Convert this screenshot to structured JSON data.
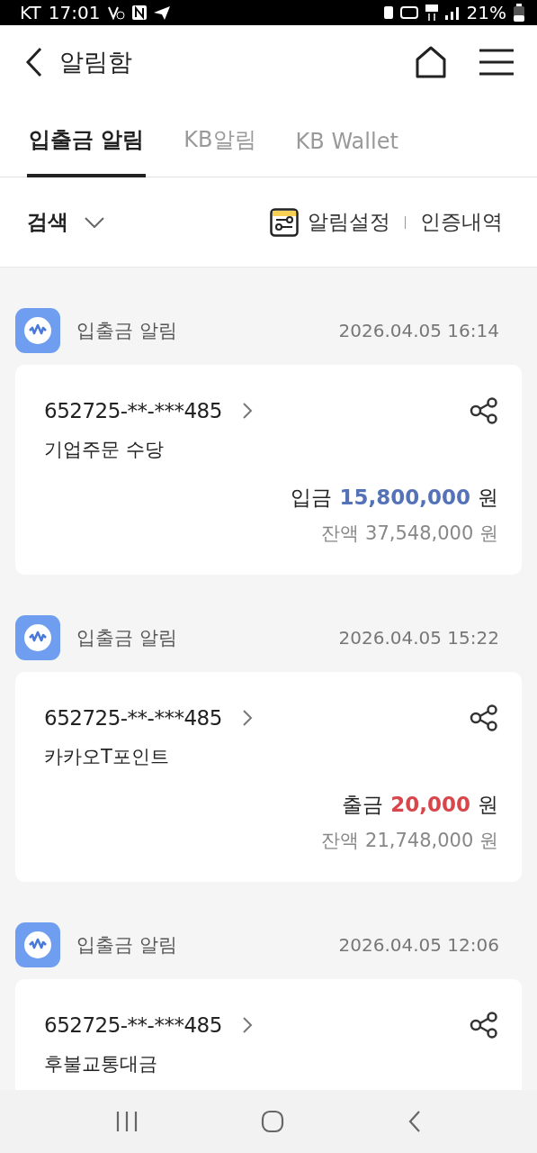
{
  "status_bar": {
    "carrier": "KT",
    "time": "17:01",
    "battery": "21%"
  },
  "header": {
    "title": "알림함"
  },
  "tabs": [
    {
      "label": "입출금 알림",
      "selected": true
    },
    {
      "label": "KB알림",
      "selected": false
    },
    {
      "label": "KB Wallet",
      "selected": false
    }
  ],
  "filter": {
    "search": "검색",
    "settings": "알림설정",
    "history": "인증내역"
  },
  "notifications": [
    {
      "source": "입출금 알림",
      "time": "2026.04.05 16:14",
      "account": "652725-**-***485",
      "description": "기업주문 수당",
      "kind": "deposit",
      "type_label": "입금",
      "amount": "15,800,000",
      "unit": "원",
      "balance": "잔액 37,548,000 원"
    },
    {
      "source": "입출금 알림",
      "time": "2026.04.05 15:22",
      "account": "652725-**-***485",
      "description": "카카오T포인트",
      "kind": "withdrawal",
      "type_label": "출금",
      "amount": "20,000",
      "unit": "원",
      "balance": "잔액 21,748,000 원"
    },
    {
      "source": "입출금 알림",
      "time": "2026.04.05 12:06",
      "account": "652725-**-***485",
      "description": "후불교통대금"
    }
  ]
}
